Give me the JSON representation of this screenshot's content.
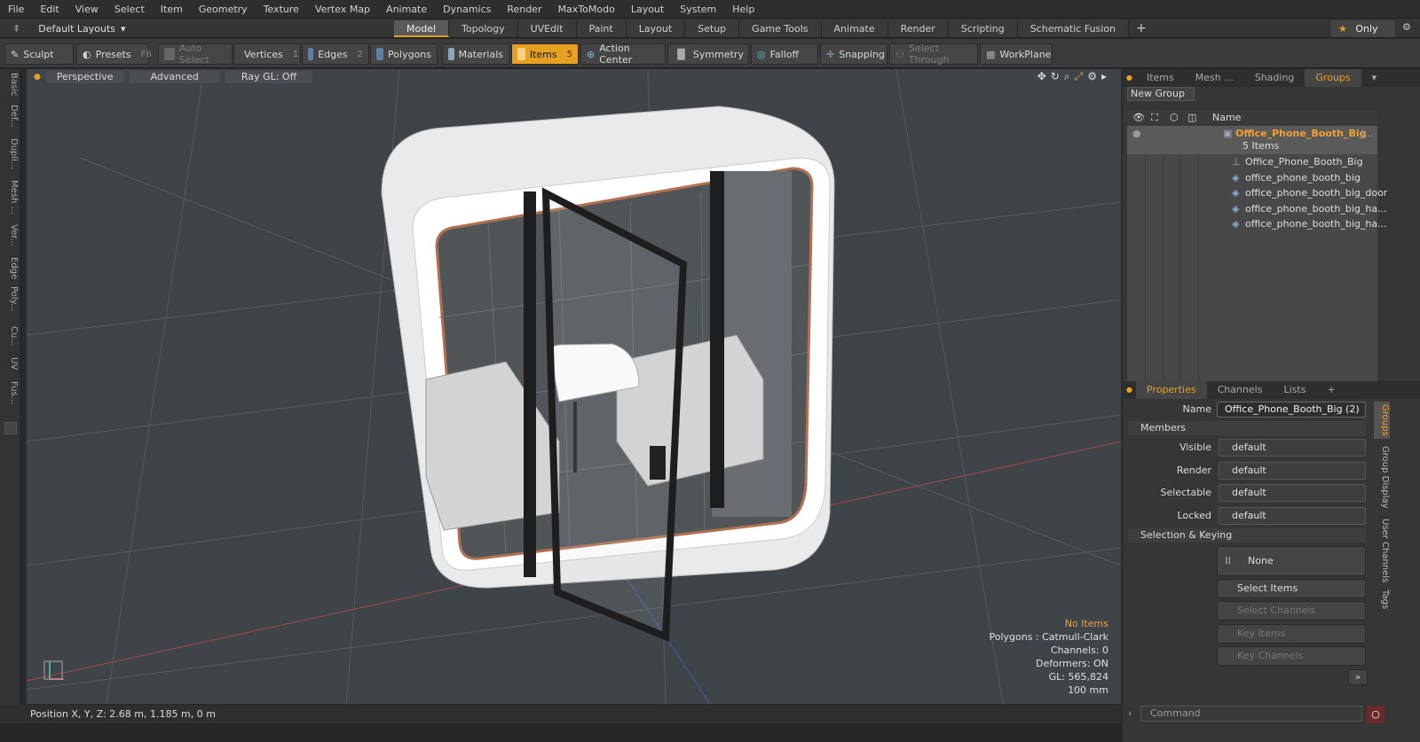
{
  "menu": [
    "File",
    "Edit",
    "View",
    "Select",
    "Item",
    "Geometry",
    "Texture",
    "Vertex Map",
    "Animate",
    "Dynamics",
    "Render",
    "MaxToModo",
    "Layout",
    "System",
    "Help"
  ],
  "layouts": {
    "label": "Default Layouts"
  },
  "main_tabs": [
    "Model",
    "Topology",
    "UVEdit",
    "Paint",
    "Layout",
    "Setup",
    "Game Tools",
    "Animate",
    "Render",
    "Scripting",
    "Schematic Fusion"
  ],
  "only_label": "Only",
  "toolbar": {
    "sculpt": "Sculpt",
    "presets": "Presets",
    "presets_key": "F6",
    "auto_select": "Auto Select",
    "vertices": "Vertices",
    "vertices_key": "1",
    "edges": "Edges",
    "edges_key": "2",
    "polygons": "Polygons",
    "materials": "Materials",
    "items": "Items",
    "items_key": "5",
    "action_center": "Action Center",
    "symmetry": "Symmetry",
    "falloff": "Falloff",
    "snapping": "Snapping",
    "select_through": "Select Through",
    "workplane": "WorkPlane"
  },
  "left_tabs": [
    "Basic",
    "Def...",
    "Dupli...",
    "Mesh ...",
    "Ver...",
    "Edge",
    "Poly...",
    "Cu...",
    "UV",
    "Fus..."
  ],
  "viewport": {
    "perspective": "Perspective",
    "advanced": "Advanced",
    "raygl": "Ray GL: Off",
    "info": {
      "no_items": "No Items",
      "polygons": "Polygons : Catmull-Clark",
      "channels": "Channels: 0",
      "deformers": "Deformers: ON",
      "gl": "GL: 565,824",
      "scale": "100 mm"
    }
  },
  "status": {
    "position": "Position X, Y, Z:  2.68 m, 1.185 m, 0 m"
  },
  "outliner": {
    "tabs": [
      "Items",
      "Mesh ...",
      "Shading",
      "Groups"
    ],
    "new_group": "New Group",
    "col_name": "Name",
    "group": "Office_Phone_Booth_Big",
    "group_suffix": "(...",
    "count": "5 Items",
    "items": [
      "Office_Phone_Booth_Big",
      "office_phone_booth_big",
      "office_phone_booth_big_door",
      "office_phone_booth_big_ha...",
      "office_phone_booth_big_ha..."
    ]
  },
  "properties": {
    "tabs": [
      "Properties",
      "Channels",
      "Lists"
    ],
    "name_label": "Name",
    "name_value": "Office_Phone_Booth_Big (2)",
    "members": "Members",
    "rows": [
      {
        "label": "Visible",
        "value": "default"
      },
      {
        "label": "Render",
        "value": "default"
      },
      {
        "label": "Selectable",
        "value": "default"
      },
      {
        "label": "Locked",
        "value": "default"
      }
    ],
    "selection_keying": "Selection & Keying",
    "none": "None",
    "select_items": "Select Items",
    "select_channels": "Select Channels",
    "key_items": "Key Items",
    "key_channels": "Key Channels"
  },
  "side_tabs": [
    "Groups",
    "Group Display",
    "User Channels",
    "Tags"
  ],
  "command": {
    "placeholder": "Command"
  }
}
